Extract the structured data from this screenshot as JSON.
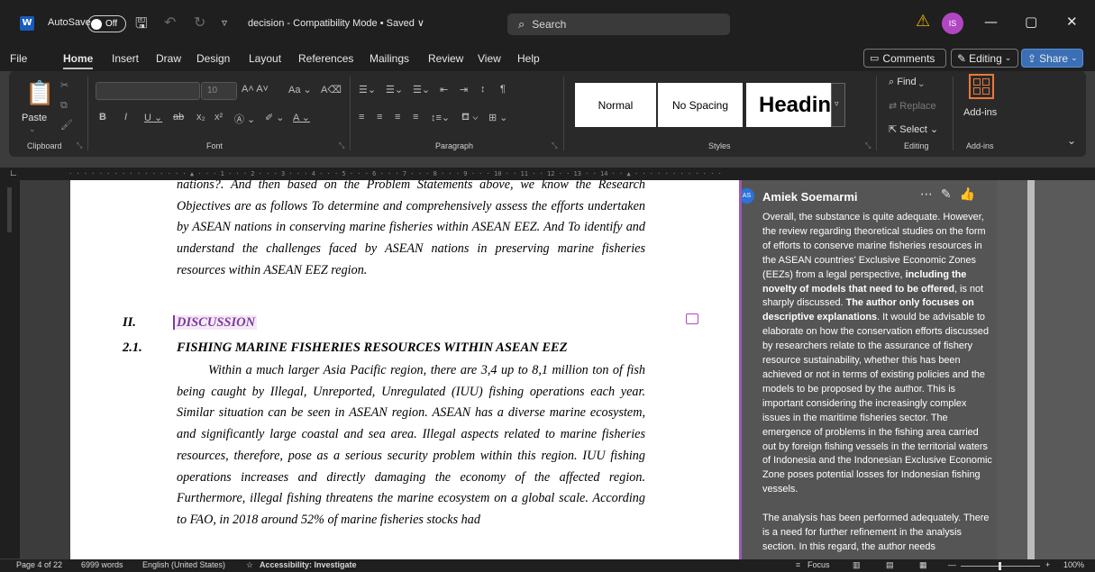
{
  "titlebar": {
    "app_icon": "word-logo-icon",
    "app_letter": "W",
    "autosave_label": "AutoSave",
    "autosave_state": "Off",
    "doc_title": "decision  -  Compatibility Mode • Saved ∨",
    "search_placeholder": "Search",
    "user_initials": "IS"
  },
  "tabs": {
    "items": [
      "File",
      "Home",
      "Insert",
      "Draw",
      "Design",
      "Layout",
      "References",
      "Mailings",
      "Review",
      "View",
      "Help"
    ],
    "active": "Home",
    "comments_label": "Comments",
    "editing_label": "Editing",
    "share_label": "Share"
  },
  "ribbon": {
    "clipboard": {
      "paste_label": "Paste",
      "group_label": "Clipboard"
    },
    "font": {
      "size_value": "10",
      "group_label": "Font"
    },
    "paragraph": {
      "group_label": "Paragraph"
    },
    "styles": {
      "items": [
        "Normal",
        "No Spacing",
        "Headin"
      ],
      "group_label": "Styles"
    },
    "editing": {
      "find_label": "Find",
      "replace_label": "Replace",
      "select_label": "Select",
      "group_label": "Editing"
    },
    "addins": {
      "label": "Add-ins",
      "group_label": "Add-ins"
    }
  },
  "document": {
    "para1": "nations?. And then based on the Problem Statements above, we know the Research Objectives are as follows To determine and comprehensively assess the efforts undertaken by ASEAN nations in conserving marine fisheries within ASEAN EEZ. And To identify and understand the challenges faced by ASEAN nations in preserving marine fisheries resources within ASEAN EEZ region.",
    "heading_num": "II.",
    "heading_text": "DISCUSSION",
    "subheading_num": "2.1.",
    "subheading_text": "FISHING MARINE FISHERIES RESOURCES WITHIN ASEAN EEZ",
    "para2": "Within a much larger Asia Pacific region, there are 3,4 up to 8,1 million ton of fish being caught by Illegal, Unreported, Unregulated (IUU) fishing operations each year. Similar situation can be seen in ASEAN region. ASEAN has a diverse marine ecosystem, and significantly large coastal and sea area. Illegal aspects related to marine fisheries resources, therefore, pose as a serious security problem within this region. IUU fishing operations increases and directly damaging the economy of the affected region. Furthermore, illegal fishing threatens the marine ecosystem on a global scale. According to FAO, in 2018 around 52% of marine fisheries stocks had"
  },
  "comment": {
    "initials": "AS",
    "author": "Amiek Soemarmi",
    "body_p1_a": "Overall, the substance is quite adequate. However, the review regarding theoretical studies on the form of efforts to conserve marine fisheries resources in the ASEAN countries' Exclusive Economic Zones (EEZs) from a legal perspective, ",
    "body_p1_b": "including the novelty of models that need to be offered",
    "body_p1_c": ", is not sharply discussed. ",
    "body_p1_d": "The author only focuses on descriptive explanations",
    "body_p1_e": ". It would be advisable to elaborate on how the conservation efforts discussed by researchers relate to the assurance of fishery resource sustainability, whether this has been achieved or not in terms of existing policies and the models to be proposed by the author. This is important considering the increasingly complex issues in the maritime fisheries sector. The emergence of problems in the fishing area carried out by foreign fishing vessels in the territorial waters of Indonesia and the Indonesian Exclusive Economic Zone poses potential losses for Indonesian fishing vessels.",
    "body_p2": "The analysis has been performed adequately. There is a need for further refinement in the analysis section. In this regard, the author needs"
  },
  "status": {
    "page": "Page 4 of 22",
    "words": "6999 words",
    "language": "English (United States)",
    "accessibility": "Accessibility: Investigate",
    "focus": "Focus",
    "zoom": "100%"
  }
}
